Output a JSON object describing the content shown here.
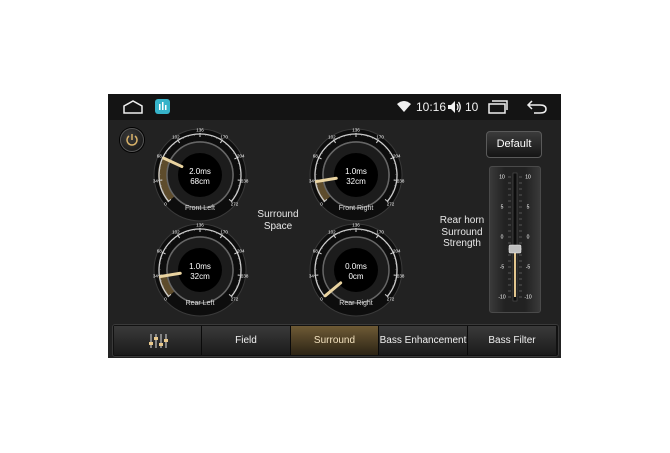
{
  "status_bar": {
    "home_icon": "home-icon",
    "app_icon": "equalizer-app-icon",
    "wifi_icon": "wifi-icon",
    "time": "10:16",
    "volume_icon": "speaker-icon",
    "volume": "10",
    "recents_icon": "recent-apps-icon",
    "back_icon": "back-arrow-icon"
  },
  "power_icon": "power-icon",
  "default_button": "Default",
  "center_label": "Surround\nSpace",
  "rear_horn_label": "Rear horn\nSurround\nStrength",
  "dial_ticks": [
    "0",
    "34",
    "68",
    "102",
    "136",
    "170",
    "204",
    "238",
    "272"
  ],
  "dials": [
    {
      "name": "Front Left",
      "time": "2.0ms",
      "distance": "68cm",
      "value": 68
    },
    {
      "name": "Front Right",
      "time": "1.0ms",
      "distance": "32cm",
      "value": 32
    },
    {
      "name": "Rear Left",
      "time": "1.0ms",
      "distance": "32cm",
      "value": 32
    },
    {
      "name": "Rear Right",
      "time": "0.0ms",
      "distance": "0cm",
      "value": 0
    }
  ],
  "slider": {
    "ticks": [
      "10",
      "5",
      "0",
      "-5",
      "-10"
    ],
    "value": -2
  },
  "tabs": [
    {
      "label": "",
      "icon": "equalizer-sliders-icon"
    },
    {
      "label": "Field"
    },
    {
      "label": "Surround",
      "active": true
    },
    {
      "label": "Bass Enhancement"
    },
    {
      "label": "Bass Filter"
    }
  ],
  "colors": {
    "accent": "#c9a86a",
    "screen_bg": "#222222",
    "status_bg": "#141414"
  }
}
